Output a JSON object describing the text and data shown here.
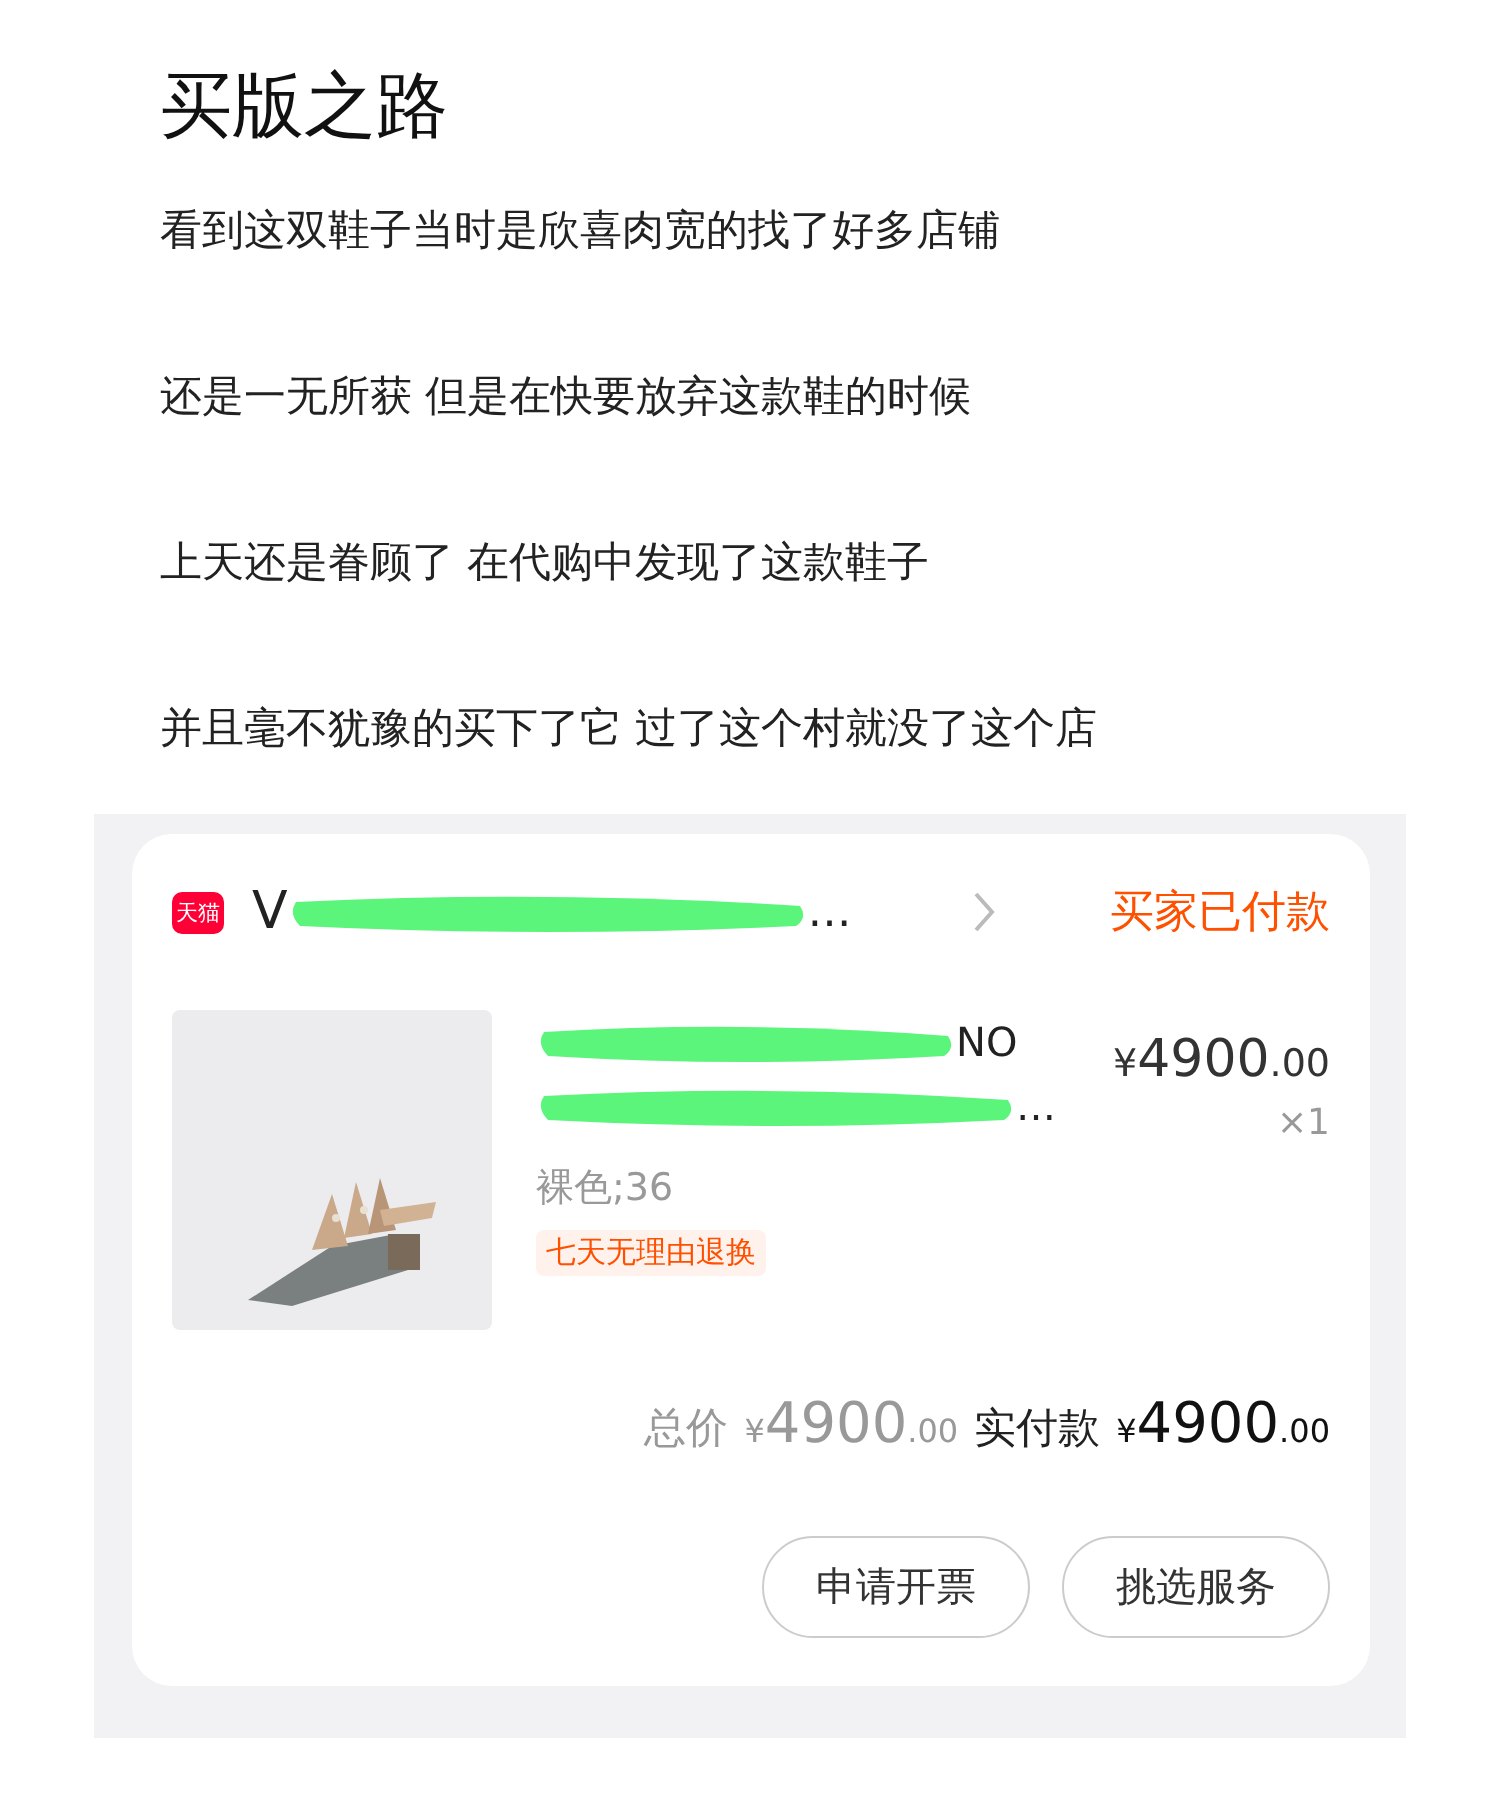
{
  "title": "买版之路",
  "paragraphs": [
    "看到这双鞋子当时是欣喜肉宽的找了好多店铺",
    "还是一无所获 但是在快要放弃这款鞋的时候",
    "上天还是眷顾了 在代购中发现了这款鞋子",
    "并且毫不犹豫的买下了它 过了这个村就没了这个店"
  ],
  "order": {
    "shop": {
      "badge": "天猫",
      "name_start": "V",
      "name_end": "…",
      "redacted": true
    },
    "status": "买家已付款",
    "item": {
      "title_line_1_end": "NO",
      "title_line_2_end": "…",
      "redacted": true,
      "variant": "裸色;36",
      "tag": "七天无理由退换",
      "price": {
        "currency": "¥",
        "whole": "4900",
        "fraction": ".00"
      },
      "quantity": "×1"
    },
    "total": {
      "label": "总价",
      "currency": "¥",
      "whole": "4900",
      "fraction": ".00"
    },
    "paid": {
      "label": "实付款",
      "currency": "¥",
      "whole": "4900",
      "fraction": ".00"
    },
    "buttons": [
      "申请开票",
      "挑选服务"
    ]
  }
}
